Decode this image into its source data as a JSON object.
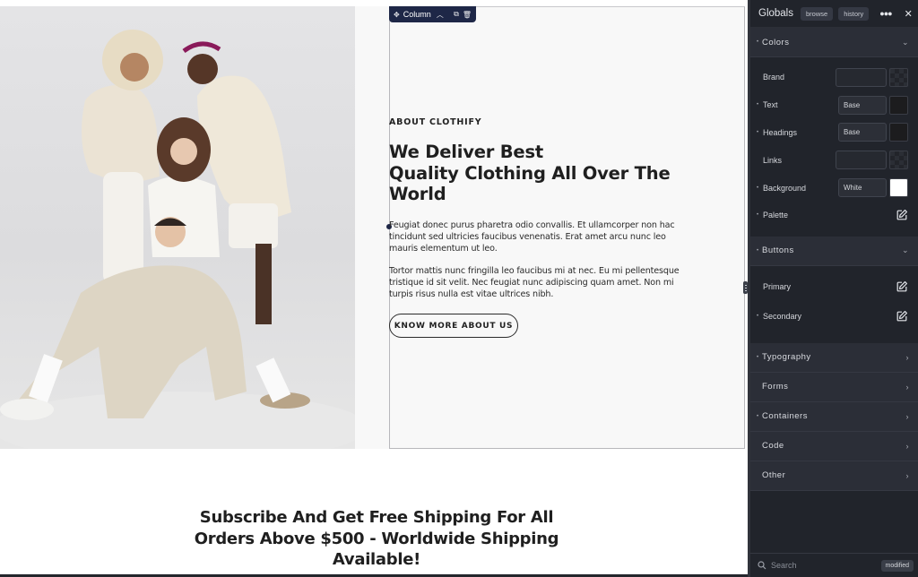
{
  "canvas": {
    "column_toolbar": {
      "label": "Column",
      "icons": [
        "move-icon",
        "chevron-up-icon",
        "duplicate-icon",
        "trash-icon"
      ]
    },
    "about": {
      "eyebrow": "ABOUT CLOTHIFY",
      "headline_line1": "We Deliver Best",
      "headline_line2": "Quality Clothing All Over The",
      "headline_line3": "World",
      "paragraph1": "Feugiat donec purus pharetra odio convallis. Et ullamcorper non hac tincidunt sed ultricies faucibus venenatis. Erat amet arcu nunc leo mauris elementum ut leo.",
      "paragraph2": "Tortor mattis nunc fringilla leo faucibus mi at nec. Eu mi pellentesque tristique id sit velit. Nec feugiat nunc adipiscing quam amet. Non mi turpis risus nulla est vitae ultrices nibh.",
      "cta_label": "KNOW MORE ABOUT US"
    },
    "image_alt": "Four models in cream and white clothing posing together",
    "subscribe": {
      "line1": "Subscribe And Get Free Shipping For All",
      "line2": "Orders Above $500 - Worldwide Shipping",
      "line3": "Available!"
    }
  },
  "panel": {
    "title": "Globals",
    "chips": [
      "browse",
      "history"
    ],
    "more_icon": "more-horizontal-icon",
    "close_icon": "close-icon",
    "sections": {
      "colors": {
        "label": "Colors",
        "rows": [
          {
            "label": "Brand",
            "value": "",
            "swatch": "empty"
          },
          {
            "label": "Text",
            "value": "Base",
            "swatch": "#1c1c1e"
          },
          {
            "label": "Headings",
            "value": "Base",
            "swatch": "#1c1c1e"
          },
          {
            "label": "Links",
            "value": "",
            "swatch": "empty"
          },
          {
            "label": "Background",
            "value": "White",
            "swatch": "#ffffff"
          },
          {
            "label": "Palette"
          }
        ]
      },
      "buttons": {
        "label": "Buttons",
        "rows": [
          {
            "label": "Primary"
          },
          {
            "label": "Secondary"
          }
        ]
      },
      "collapsed": [
        "Typography",
        "Forms",
        "Containers",
        "Code",
        "Other"
      ]
    },
    "footer": {
      "search_placeholder": "Search",
      "badge": "modified"
    }
  },
  "colors": {
    "accent": "#1e2747",
    "panel_bg": "#21242b",
    "section_header_bg": "#2b2e37",
    "text_dark": "#1f1f1f"
  }
}
